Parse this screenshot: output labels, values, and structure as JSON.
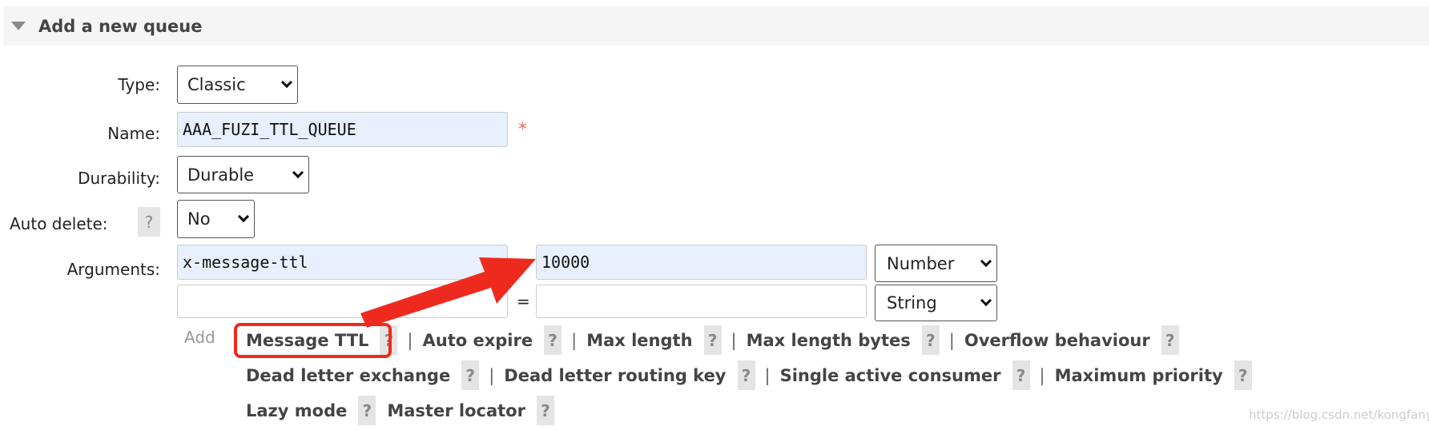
{
  "section": {
    "title": "Add a new queue",
    "collapse_icon": "triangle-down-icon"
  },
  "form": {
    "type": {
      "label": "Type:",
      "value": "Classic"
    },
    "name": {
      "label": "Name:",
      "value": "AAA_FUZI_TTL_QUEUE",
      "required_mark": "*"
    },
    "durability": {
      "label": "Durability:",
      "value": "Durable"
    },
    "auto_delete": {
      "label": "Auto delete:",
      "help": "?",
      "value": "No"
    },
    "arguments": {
      "label": "Arguments:",
      "eq": "=",
      "rows": [
        {
          "key": "x-message-ttl",
          "value": "10000",
          "type": "Number"
        },
        {
          "key": "",
          "value": "",
          "type": "String"
        }
      ]
    },
    "add_label": "Add",
    "help": "?",
    "pipe": "|",
    "shortcuts": [
      [
        "Message TTL",
        "Auto expire",
        "Max length",
        "Max length bytes",
        "Overflow behaviour"
      ],
      [
        "Dead letter exchange",
        "Dead letter routing key",
        "Single active consumer",
        "Maximum priority"
      ],
      [
        "Lazy mode",
        "Master locator"
      ]
    ]
  },
  "annotation_color": "#ee2a1e",
  "watermark": "https://blog.csdn.net/kongfanyu"
}
